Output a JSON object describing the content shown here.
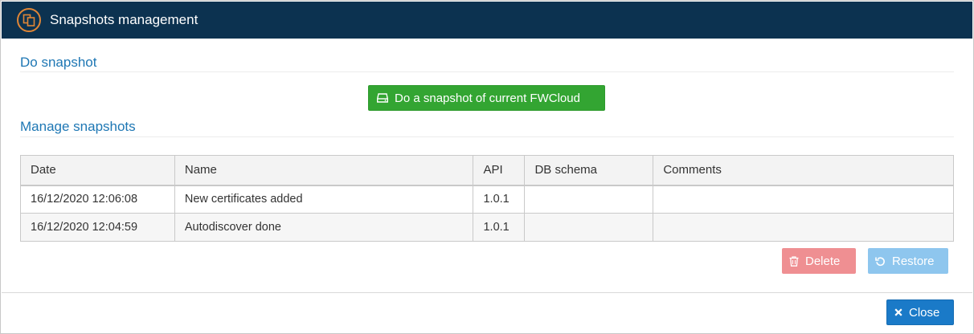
{
  "dialog": {
    "title": "Snapshots management",
    "title_icon": "copy-icon",
    "accent_color": "#e08636",
    "header_color": "#0c3250"
  },
  "do_snapshot": {
    "heading": "Do snapshot",
    "button_label": "Do a snapshot of current FWCloud",
    "button_icon": "hdd-icon",
    "button_color": "#33a532"
  },
  "manage": {
    "heading": "Manage snapshots",
    "columns": [
      "Date",
      "Name",
      "API",
      "DB schema",
      "Comments"
    ],
    "rows": [
      {
        "date": "16/12/2020 12:06:08",
        "name": "New certificates added",
        "api": "1.0.1",
        "db_schema": "",
        "comments": ""
      },
      {
        "date": "16/12/2020 12:04:59",
        "name": "Autodiscover done",
        "api": "1.0.1",
        "db_schema": "",
        "comments": ""
      }
    ],
    "delete_label": "Delete",
    "delete_icon": "trash-icon",
    "restore_label": "Restore",
    "restore_icon": "undo-icon"
  },
  "footer": {
    "close_label": "Close",
    "close_icon": "times-icon"
  }
}
